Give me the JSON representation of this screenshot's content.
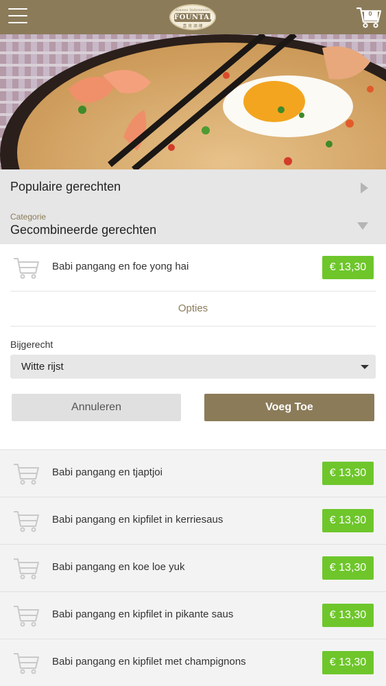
{
  "header": {
    "logo_top": "Chinees Indonesisch",
    "logo_name": "FOUNTAIN",
    "logo_sub": "喜 來 酒 樓",
    "cart_count": "0"
  },
  "menu": {
    "popular_label": "Populaire gerechten",
    "category_caption": "Categorie",
    "category_value": "Gecombineerde gerechten"
  },
  "selected_item": {
    "name": "Babi pangang en foe yong hai",
    "price": "€ 13,30",
    "options_label": "Opties",
    "side_label": "Bijgerecht",
    "side_value": "Witte rijst",
    "cancel_label": "Annuleren",
    "add_label": "Voeg Toe"
  },
  "items": [
    {
      "name": "Babi pangang en tjaptjoi",
      "price": "€ 13,30"
    },
    {
      "name": "Babi pangang en kipfilet in kerriesaus",
      "price": "€ 13,30"
    },
    {
      "name": "Babi pangang en koe loe yuk",
      "price": "€ 13,30"
    },
    {
      "name": "Babi pangang en kipfilet in pikante saus",
      "price": "€ 13,30"
    },
    {
      "name": "Babi pangang en kipfilet met champignons",
      "price": "€ 13,30"
    }
  ],
  "colors": {
    "brand": "#8b7b59",
    "price_green": "#6ec62b",
    "panel_grey": "#e6e6e6"
  }
}
